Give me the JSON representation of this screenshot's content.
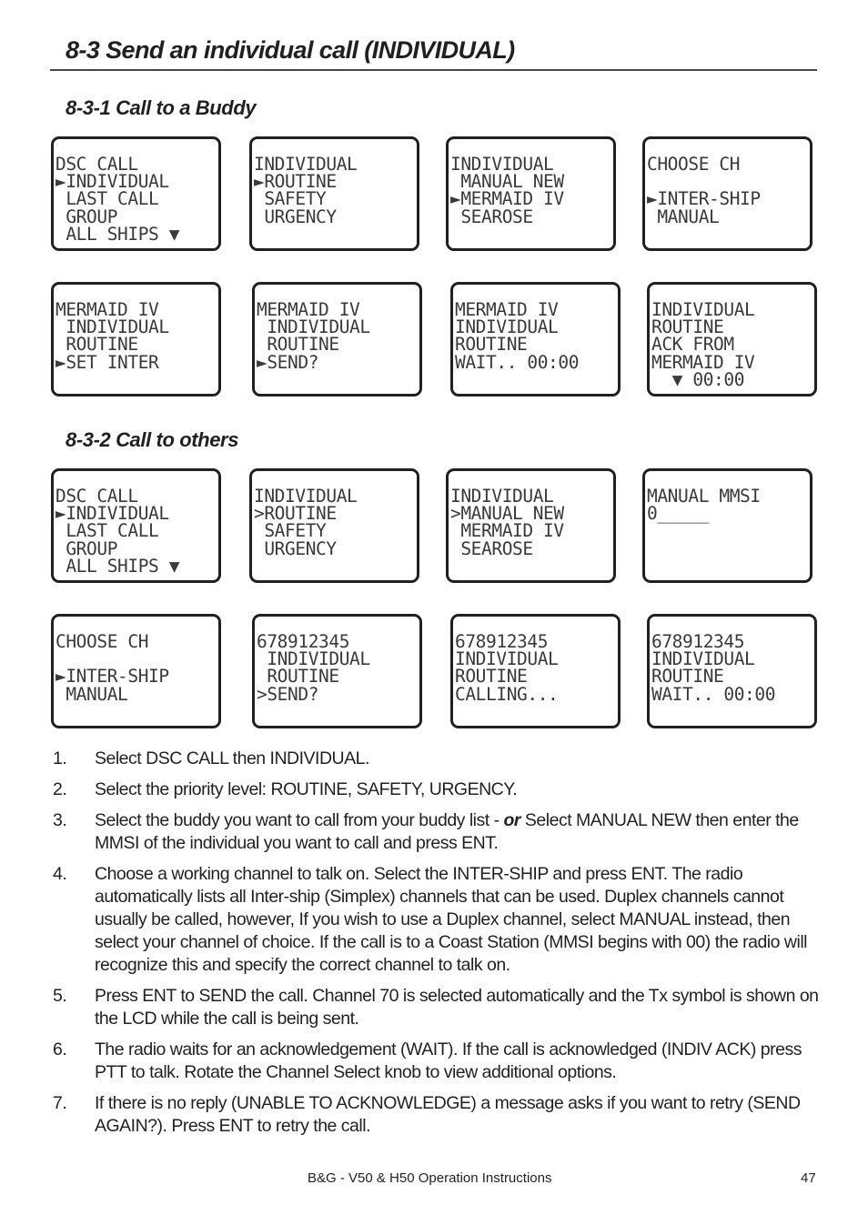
{
  "page": {
    "title": "8-3 Send an individual call (INDIVIDUAL)",
    "sections": [
      {
        "heading": "8-3-1 Call to a Buddy",
        "screens": [
          {
            "lines": [
              "DSC CALL",
              "►INDIVIDUAL",
              " LAST CALL",
              " GROUP",
              " ALL SHIPS ▼"
            ]
          },
          {
            "lines": [
              "INDIVIDUAL",
              "►ROUTINE",
              " SAFETY",
              " URGENCY"
            ]
          },
          {
            "lines": [
              "INDIVIDUAL",
              " MANUAL NEW",
              "►MERMAID IV",
              " SEAROSE"
            ]
          },
          {
            "lines": [
              "CHOOSE CH",
              "",
              "►INTER-SHIP",
              " MANUAL"
            ]
          },
          {
            "lines": [
              "MERMAID IV",
              " INDIVIDUAL",
              " ROUTINE",
              "►SET INTER"
            ]
          },
          {
            "lines": [
              "MERMAID IV",
              " INDIVIDUAL",
              " ROUTINE",
              "►SEND?"
            ]
          },
          {
            "lines": [
              "MERMAID IV",
              "INDIVIDUAL",
              "ROUTINE",
              "WAIT.. 00:00"
            ]
          },
          {
            "lines": [
              "INDIVIDUAL",
              "ROUTINE",
              "ACK FROM",
              "MERMAID IV",
              "  ▼ 00:00"
            ]
          }
        ]
      },
      {
        "heading": "8-3-2 Call to others",
        "screens": [
          {
            "lines": [
              "DSC CALL",
              "►INDIVIDUAL",
              " LAST CALL",
              " GROUP",
              " ALL SHIPS ▼"
            ]
          },
          {
            "lines": [
              "INDIVIDUAL",
              ">ROUTINE",
              " SAFETY",
              " URGENCY"
            ]
          },
          {
            "lines": [
              "INDIVIDUAL",
              ">MANUAL NEW",
              " MERMAID IV",
              " SEAROSE"
            ]
          },
          {
            "lines": [
              "MANUAL MMSI",
              "0_____"
            ]
          },
          {
            "lines": [
              "CHOOSE CH",
              "",
              "►INTER-SHIP",
              " MANUAL"
            ]
          },
          {
            "lines": [
              "678912345",
              " INDIVIDUAL",
              " ROUTINE",
              ">SEND?"
            ]
          },
          {
            "lines": [
              "678912345",
              "INDIVIDUAL",
              "ROUTINE",
              "CALLING..."
            ]
          },
          {
            "lines": [
              "678912345",
              "INDIVIDUAL",
              "ROUTINE",
              "WAIT.. 00:00"
            ]
          }
        ]
      }
    ],
    "steps": [
      {
        "num": "1.",
        "text": "Select DSC CALL then INDIVIDUAL."
      },
      {
        "num": "2.",
        "text": "Select the priority level: ROUTINE, SAFETY, URGENCY."
      },
      {
        "num": "3.",
        "pre": "Select the buddy you want to call from your buddy list - ",
        "emph": "or",
        "post": " Select MANUAL NEW then enter the MMSI of the individual you want to call and press ENT."
      },
      {
        "num": "4.",
        "text": "Choose a working channel to talk on. Select the INTER-SHIP and press ENT. The radio automatically lists all Inter-ship (Simplex) channels that can be used. Duplex channels cannot usually be called, however, If you wish to use a Duplex channel, select MANUAL instead, then select your channel of choice. If the call is to a Coast Station (MMSI begins with 00) the radio will recognize this and specify the correct channel to talk on."
      },
      {
        "num": "5.",
        "text": "Press ENT to SEND the call. Channel 70 is selected automatically and the Tx symbol is shown on the LCD while the call is being sent."
      },
      {
        "num": "6.",
        "text": "The radio waits for an acknowledgement (WAIT). If the call is acknowledged (INDIV ACK) press PTT to talk. Rotate the Channel Select knob to view additional options."
      },
      {
        "num": "7.",
        "text": "If there is no reply (UNABLE TO ACKNOWLEDGE) a message asks if you want to retry (SEND AGAIN?). Press ENT to retry the call."
      }
    ],
    "footer": {
      "doc_title": "B&G - V50 & H50 Operation Instructions",
      "page_number": "47"
    }
  }
}
